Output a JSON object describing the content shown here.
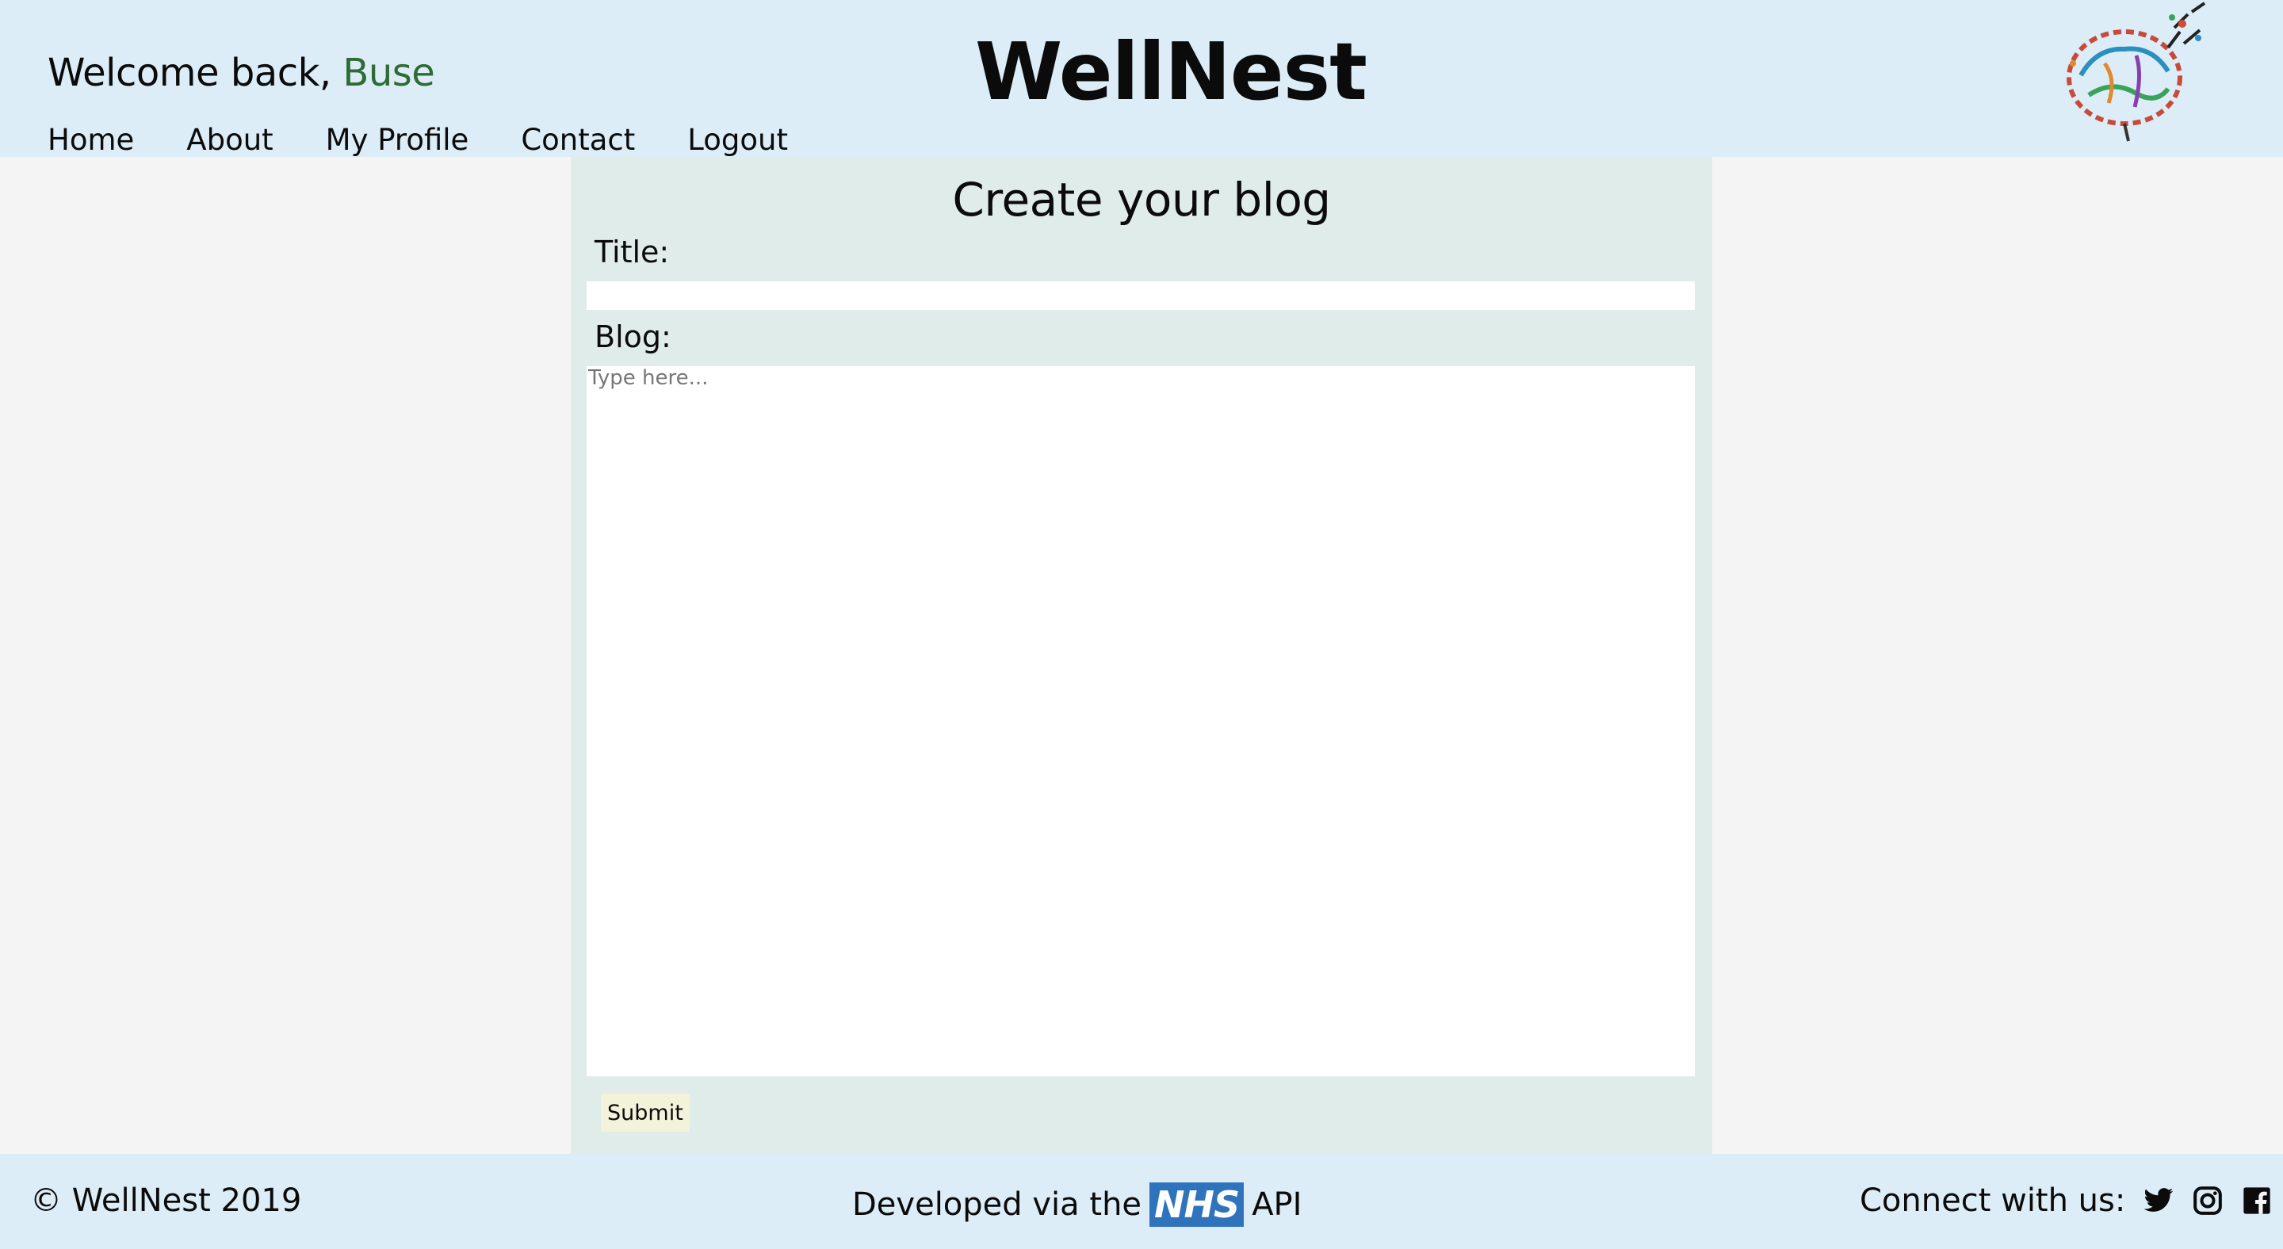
{
  "header": {
    "welcome_prefix": "Welcome back, ",
    "username": "Buse",
    "site_title": "WellNest",
    "nav": [
      "Home",
      "About",
      "My Profile",
      "Contact",
      "Logout"
    ],
    "logo_icon": "brain-logo-icon"
  },
  "form": {
    "heading": "Create your blog",
    "title_label": "Title:",
    "title_value": "",
    "blog_label": "Blog:",
    "blog_placeholder": "Type here...",
    "submit_label": "Submit"
  },
  "footer": {
    "copyright": "© WellNest 2019",
    "developed_prefix": "Developed via the",
    "nhs_logo": "NHS",
    "developed_suffix": "API",
    "connect": "Connect with us:",
    "social_icons": [
      "twitter-icon",
      "instagram-icon",
      "facebook-icon"
    ]
  },
  "colors": {
    "header_bg": "#dcedf7",
    "panel_bg": "#e0ece9",
    "page_bg": "#f4f4f4",
    "username": "#2f6b35",
    "nhs_blue": "#2f73bd",
    "submit_bg": "#f3f3dc"
  }
}
